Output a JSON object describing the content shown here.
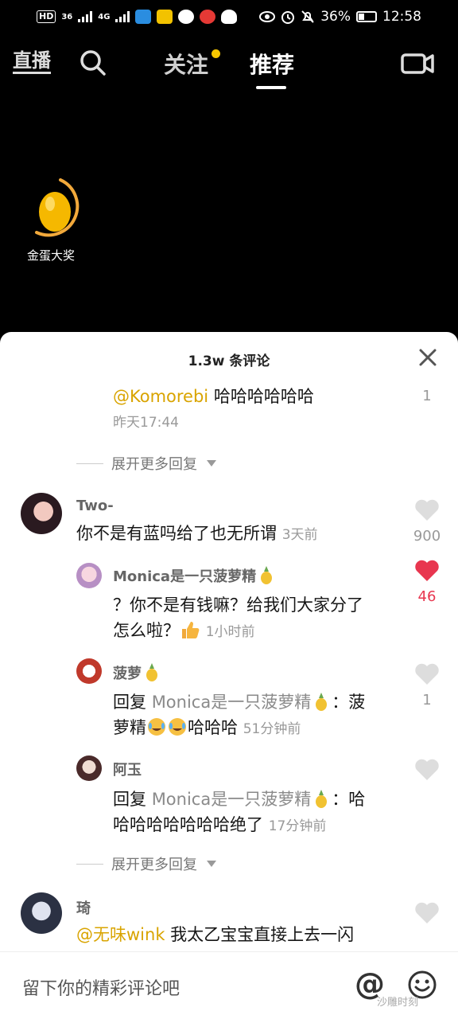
{
  "status_bar": {
    "hd_tag": "HD",
    "net1": "36",
    "net2": "4G",
    "battery": "36%",
    "time": "12:58"
  },
  "top_nav": {
    "live": "直播",
    "follow": "关注",
    "recommend": "推荐"
  },
  "golden_egg": {
    "label": "金蛋大奖"
  },
  "sheet": {
    "title": "1.3w 条评论",
    "comments": [
      {
        "mention": "@Komorebi",
        "text": " 哈哈哈哈哈哈",
        "time": "昨天17:44",
        "likes": "1"
      },
      {
        "expand": "展开更多回复"
      },
      {
        "name": "Two-",
        "text": "你不是有蓝吗给了也无所谓",
        "time": "3天前",
        "likes": "900"
      },
      {
        "name": "Monica是一只菠萝精",
        "text_line1": "？你不是有钱嘛？给我们大家分了",
        "text_line2": "怎么啦？",
        "time": "1小时前",
        "likes": "46"
      },
      {
        "name": "菠萝",
        "reply_prefix": "回复 ",
        "reply_target": "Monica是一只菠萝精",
        "reply_colon": "：菠",
        "text_line2": "萝精",
        "text_tail": "哈哈哈",
        "time": "51分钟前",
        "likes": "1"
      },
      {
        "name": "阿玉",
        "reply_prefix": "回复 ",
        "reply_target": "Monica是一只菠萝精",
        "reply_colon": "：哈",
        "text_line2": "哈哈哈哈哈哈哈绝了",
        "time": "17分钟前"
      },
      {
        "expand": "展开更多回复"
      },
      {
        "name": "琦",
        "mention": "@无味wink",
        "text": " 我太乙宝宝直接上去一闪"
      }
    ]
  },
  "input": {
    "placeholder": "留下你的精彩评论吧",
    "at": "@",
    "watermark": "沙雕时刻"
  }
}
